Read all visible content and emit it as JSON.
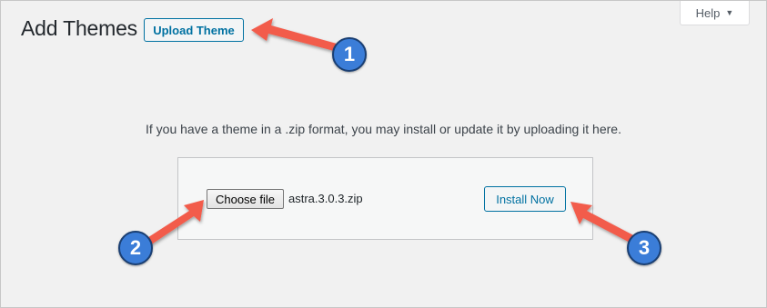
{
  "page": {
    "title": "Add Themes",
    "upload_theme_label": "Upload Theme",
    "help_label": "Help",
    "help_caret": "▼",
    "instructions": "If you have a theme in a .zip format, you may install or update it by uploading it here."
  },
  "upload_form": {
    "choose_file_label": "Choose file",
    "selected_file": "astra.3.0.3.zip",
    "install_label": "Install Now"
  },
  "annotations": {
    "callouts": [
      "1",
      "2",
      "3"
    ],
    "arrow_color": "#f25c4c",
    "badge_color": "#3b7dd8"
  }
}
